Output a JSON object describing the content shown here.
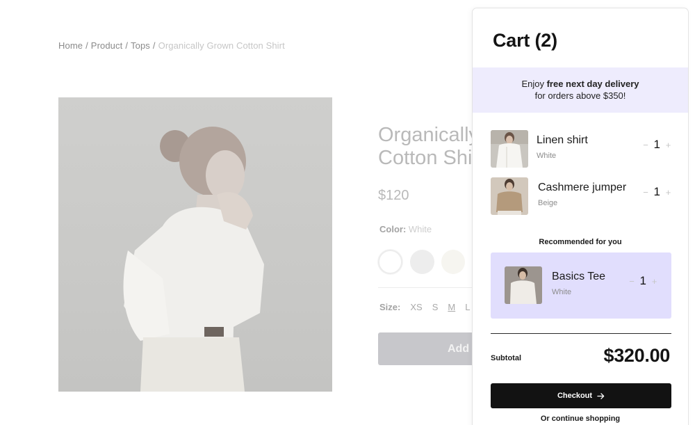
{
  "breadcrumb": {
    "items": [
      "Home",
      "Product",
      "Tops"
    ],
    "separator": "/",
    "current": "Organically Grown Cotton Shirt"
  },
  "product": {
    "title_line1": "Organically Grown",
    "title_line2": "Cotton Shirt",
    "price": "$120",
    "color_label": "Color:",
    "color_value": "White",
    "swatches": [
      "#ffffff",
      "#ededed",
      "#f6f5f0"
    ],
    "size_label": "Size:",
    "sizes": [
      "XS",
      "S",
      "M",
      "L"
    ],
    "selected_size": "M",
    "add_button_label": "Add"
  },
  "cart": {
    "title": "Cart (2)",
    "promo_prefix": "Enjoy ",
    "promo_bold": "free next day delivery",
    "promo_line2": "for orders above $350!",
    "items": [
      {
        "name": "Linen shirt",
        "variant": "White",
        "qty": "1",
        "minus": "−",
        "plus": "+"
      },
      {
        "name": "Cashmere jumper",
        "variant": "Beige",
        "qty": "1",
        "minus": "−",
        "plus": "+"
      }
    ],
    "recommended_label": "Recommended for you",
    "recommended": {
      "name": "Basics Tee",
      "variant": "White",
      "qty": "1",
      "minus": "−",
      "plus": "+"
    },
    "subtotal_label": "Subtotal",
    "subtotal_value": "$320.00",
    "checkout_label": "Checkout",
    "continue_label": "Or continue shopping"
  },
  "colors": {
    "accent_promo": "#eeecfd",
    "accent_recommended": "#e1defd",
    "checkout_bg": "#121212"
  }
}
